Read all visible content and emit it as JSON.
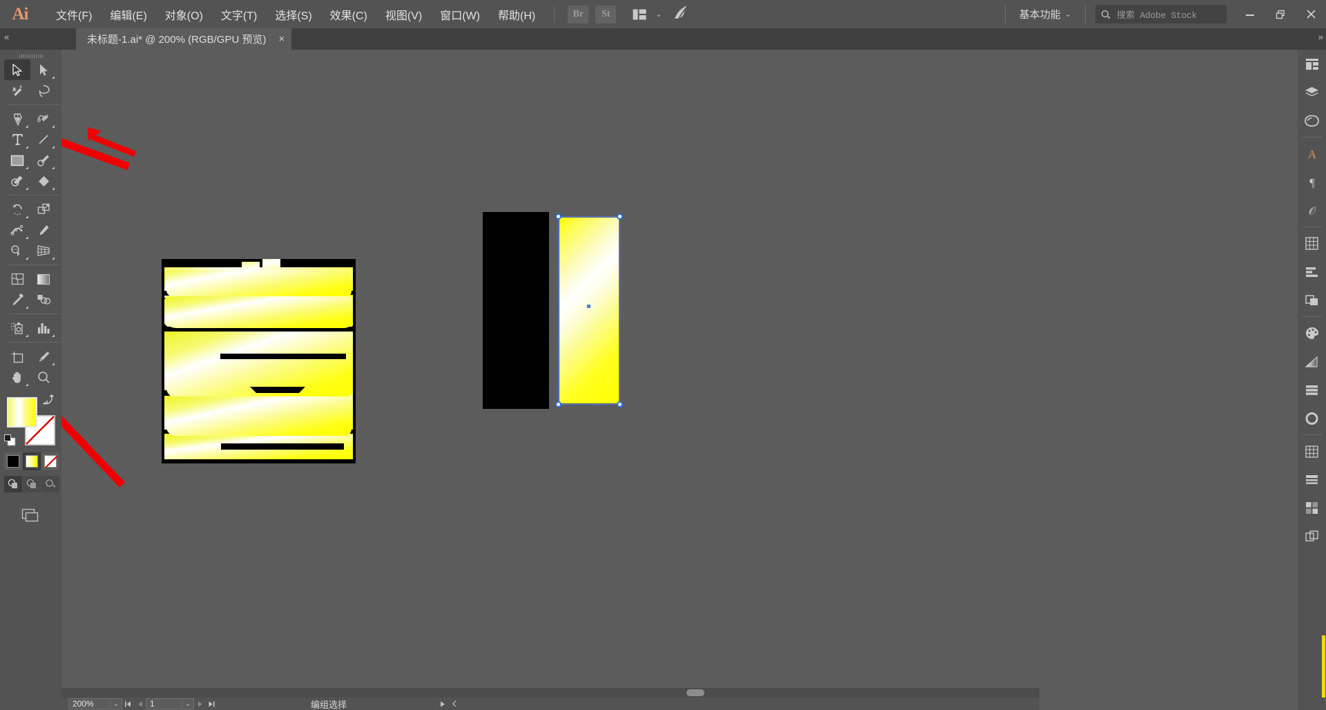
{
  "app": {
    "name": "Adobe Illustrator",
    "logo": "Ai",
    "accent_color": "#e8956b",
    "bg_color": "#5c5c5c"
  },
  "menubar": {
    "items": [
      {
        "label": "文件(F)",
        "name": "menu-file"
      },
      {
        "label": "编辑(E)",
        "name": "menu-edit"
      },
      {
        "label": "对象(O)",
        "name": "menu-object"
      },
      {
        "label": "文字(T)",
        "name": "menu-type"
      },
      {
        "label": "选择(S)",
        "name": "menu-select"
      },
      {
        "label": "效果(C)",
        "name": "menu-effect"
      },
      {
        "label": "视图(V)",
        "name": "menu-view"
      },
      {
        "label": "窗口(W)",
        "name": "menu-window"
      },
      {
        "label": "帮助(H)",
        "name": "menu-help"
      }
    ],
    "bridge_label": "Br",
    "stock_label": "St",
    "arrange_icon": "arrange-documents-icon",
    "arrange_chevron": "⌄",
    "bird_icon": "stock-bird-icon"
  },
  "workspace": {
    "label": "基本功能",
    "chevron": "⌄"
  },
  "search": {
    "placeholder_cn": "搜索",
    "placeholder_en": "Adobe Stock",
    "icon": "search-icon"
  },
  "window_controls": {
    "minimize": "minimize-icon",
    "restore": "restore-icon",
    "close": "close-icon"
  },
  "document_tab": {
    "title": "未标题-1.ai* @ 200% (RGB/GPU 预览)",
    "close": "×"
  },
  "collapse": {
    "left": "«",
    "right": "»"
  },
  "toolbar": {
    "tools": [
      {
        "name": "selection-tool",
        "label": "选择工具",
        "active": true,
        "corner": false
      },
      {
        "name": "direct-selection-tool",
        "label": "直接选择工具",
        "active": false,
        "corner": true
      },
      {
        "name": "magic-wand-tool",
        "label": "魔棒工具",
        "active": false,
        "corner": false
      },
      {
        "name": "lasso-tool",
        "label": "套索工具",
        "active": false,
        "corner": false
      },
      {
        "name": "pen-tool",
        "label": "钢笔工具",
        "active": false,
        "corner": true
      },
      {
        "name": "curvature-tool",
        "label": "曲率工具",
        "active": false,
        "corner": true
      },
      {
        "name": "type-tool",
        "label": "文字工具",
        "active": false,
        "corner": true
      },
      {
        "name": "line-segment-tool",
        "label": "直线段工具",
        "active": false,
        "corner": true
      },
      {
        "name": "rectangle-tool",
        "label": "矩形工具",
        "active": false,
        "corner": true
      },
      {
        "name": "paintbrush-tool",
        "label": "画笔工具",
        "active": false,
        "corner": true
      },
      {
        "name": "shaper-tool",
        "label": "Shaper 工具",
        "active": false,
        "corner": true
      },
      {
        "name": "eraser-tool",
        "label": "橡皮擦工具",
        "active": false,
        "corner": true
      },
      {
        "name": "rotate-tool",
        "label": "旋转工具",
        "active": false,
        "corner": true
      },
      {
        "name": "scale-tool",
        "label": "比例缩放工具",
        "active": false,
        "corner": true
      },
      {
        "name": "width-tool",
        "label": "宽度工具",
        "active": false,
        "corner": true
      },
      {
        "name": "free-transform-tool",
        "label": "自由变换工具",
        "active": false,
        "corner": false
      },
      {
        "name": "shape-builder-tool",
        "label": "形状生成器工具",
        "active": false,
        "corner": true
      },
      {
        "name": "perspective-grid-tool",
        "label": "透视网格工具",
        "active": false,
        "corner": true
      },
      {
        "name": "mesh-tool",
        "label": "网格工具",
        "active": false,
        "corner": false
      },
      {
        "name": "gradient-tool",
        "label": "渐变工具",
        "active": false,
        "corner": false
      },
      {
        "name": "eyedropper-tool",
        "label": "吸管工具",
        "active": false,
        "corner": true
      },
      {
        "name": "blend-tool",
        "label": "混合工具",
        "active": false,
        "corner": false
      },
      {
        "name": "symbol-sprayer-tool",
        "label": "符号喷枪工具",
        "active": false,
        "corner": true
      },
      {
        "name": "column-graph-tool",
        "label": "柱形图工具",
        "active": false,
        "corner": true
      },
      {
        "name": "artboard-tool",
        "label": "画板工具",
        "active": false,
        "corner": false
      },
      {
        "name": "slice-tool",
        "label": "切片工具",
        "active": false,
        "corner": true
      },
      {
        "name": "hand-tool",
        "label": "抓手工具",
        "active": false,
        "corner": true
      },
      {
        "name": "zoom-tool",
        "label": "缩放工具",
        "active": false,
        "corner": false
      }
    ],
    "fill": {
      "name": "fill-swatch",
      "label": "填色",
      "type": "gradient",
      "colors": [
        "#f3f760",
        "#ffffff",
        "#ffff00"
      ]
    },
    "stroke": {
      "name": "stroke-swatch",
      "label": "描边",
      "type": "none",
      "color": "#ffffff"
    },
    "swap_icon": "swap-fill-stroke-icon",
    "default_icon": "default-fill-stroke-icon",
    "color_modes": [
      {
        "name": "color-mode-button",
        "label": "颜色",
        "active": false,
        "swatch": "#000000"
      },
      {
        "name": "gradient-mode-button",
        "label": "渐变",
        "active": true,
        "swatch": "gradient"
      },
      {
        "name": "none-mode-button",
        "label": "无",
        "active": false,
        "swatch": "none"
      }
    ],
    "draw_modes": [
      {
        "name": "draw-normal-button",
        "label": "正常绘图",
        "active": true
      },
      {
        "name": "draw-behind-button",
        "label": "背面绘图",
        "active": false
      },
      {
        "name": "draw-inside-button",
        "label": "内部绘图",
        "active": false
      }
    ],
    "screen_mode": {
      "name": "change-screen-mode-button",
      "label": "更改屏幕模式"
    }
  },
  "canvas": {
    "artwork_character": "喜",
    "artwork_label": "喜字渐变图形",
    "black_rectangle": {
      "name": "black-rectangle-shape",
      "color": "#000000"
    },
    "selected_rectangle": {
      "name": "selected-gradient-rectangle",
      "selected": true,
      "gradient_colors": [
        "#ffff00",
        "#ffffff",
        "#ffff00"
      ],
      "selection_color": "#4f7ce8"
    },
    "annotations": [
      {
        "name": "arrow-to-rectangle-tool",
        "color": "#ef0000",
        "target": "矩形工具"
      },
      {
        "name": "arrow-to-gradient-mode",
        "color": "#ef0000",
        "target": "渐变模式按钮"
      }
    ]
  },
  "statusbar": {
    "zoom_level": "200%",
    "zoom_chevron": "⌄",
    "page_number": "1",
    "page_chevron": "⌄",
    "first_page_icon": "first-page-icon",
    "prev_page_icon": "prev-page-icon",
    "next_page_icon": "next-page-icon",
    "last_page_icon": "last-page-icon",
    "status_text": "编组选择",
    "status_play_icon": "play-icon",
    "status_prev_icon": "prev-icon"
  },
  "rightpanel": {
    "icons": [
      {
        "name": "properties-panel-icon",
        "label": "属性"
      },
      {
        "name": "layers-panel-icon",
        "label": "图层"
      },
      {
        "name": "libraries-panel-icon",
        "label": "库"
      },
      {
        "name": "character-panel-icon",
        "label": "字符"
      },
      {
        "name": "paragraph-panel-icon",
        "label": "段落"
      },
      {
        "name": "opentype-panel-icon",
        "label": "OpenType"
      },
      {
        "name": "transform-panel-icon",
        "label": "变换"
      },
      {
        "name": "align-panel-icon",
        "label": "对齐"
      },
      {
        "name": "pathfinder-panel-icon",
        "label": "路径查找器"
      },
      {
        "name": "color-panel-icon",
        "label": "颜色"
      },
      {
        "name": "gradient-panel-icon",
        "label": "渐变"
      },
      {
        "name": "appearance-panel-icon",
        "label": "外观"
      },
      {
        "name": "stroke-panel-icon",
        "label": "描边"
      },
      {
        "name": "brushes-panel-icon",
        "label": "画笔"
      },
      {
        "name": "symbols-panel-icon",
        "label": "符号"
      },
      {
        "name": "swatches-panel-icon",
        "label": "色板"
      },
      {
        "name": "artboards-panel-icon",
        "label": "画板"
      }
    ]
  }
}
